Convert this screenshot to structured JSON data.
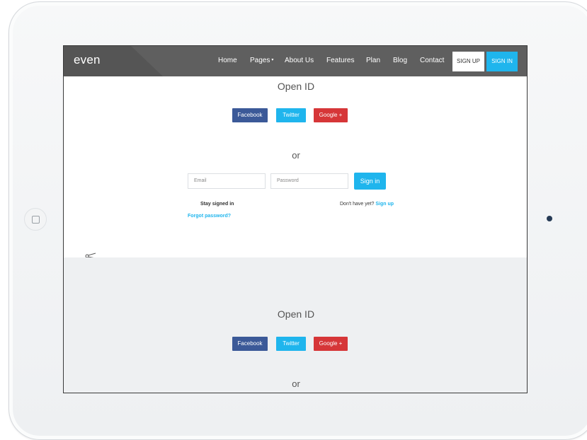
{
  "nav": {
    "logo": "even",
    "items": [
      {
        "label": "Home"
      },
      {
        "label": "Pages",
        "caret": "▾"
      },
      {
        "label": "About Us"
      },
      {
        "label": "Features"
      },
      {
        "label": "Plan"
      },
      {
        "label": "Blog"
      },
      {
        "label": "Contact"
      }
    ],
    "signup": "SIGN UP",
    "signin": "SIGN IN"
  },
  "login": {
    "heading": "Open ID",
    "social": {
      "facebook": "Facebook",
      "twitter": "Twitter",
      "google": "Google +"
    },
    "or": "or",
    "email_placeholder": "Email",
    "password_placeholder": "Password",
    "signin_button": "Sign in",
    "stay_signed_in": "Stay signed in",
    "no_account": "Don't have yet?",
    "signup_link": "Sign up",
    "forgot_password": "Forgot password?"
  },
  "second": {
    "heading": "Open ID",
    "social": {
      "facebook": "Facebook",
      "twitter": "Twitter",
      "google": "Google +"
    },
    "or": "or"
  },
  "icons": {
    "home_button": "home-button-icon",
    "scissors": "scissors-icon"
  },
  "colors": {
    "accent": "#1fb5ed",
    "facebook": "#3b5998",
    "twitter": "#1fb5ed",
    "google": "#d63638",
    "navbar": "#5f5f5f"
  }
}
